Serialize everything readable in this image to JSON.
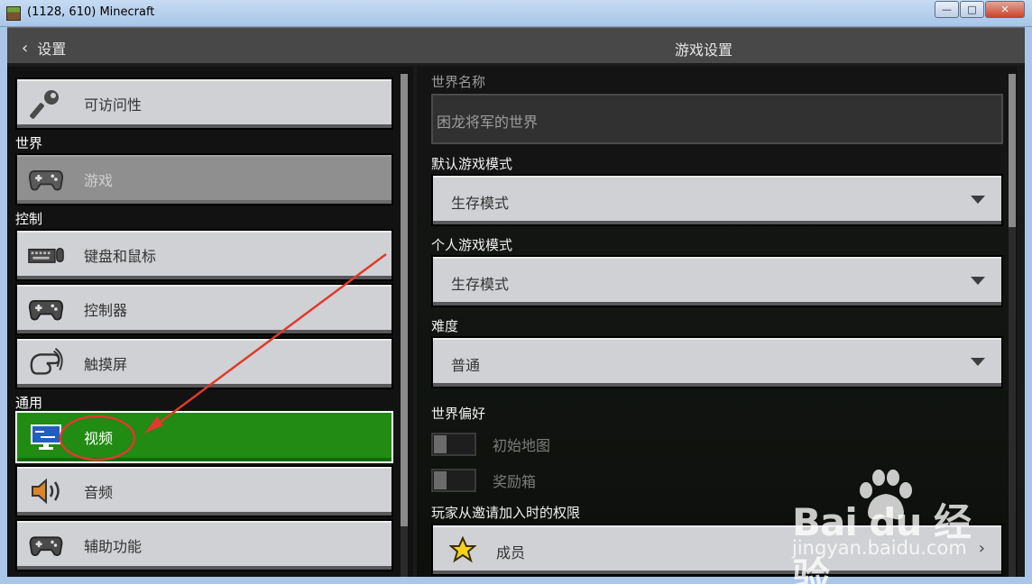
{
  "window": {
    "title": "(1128, 610) Minecraft",
    "minimize": "—",
    "maximize": "□",
    "close": "✕"
  },
  "header": {
    "back_label": "设置",
    "title": "游戏设置"
  },
  "sidebar": {
    "accessibility": {
      "label": "可访问性",
      "icon": "key-icon"
    },
    "section_world": "世界",
    "game": {
      "label": "游戏",
      "icon": "gamepad-icon",
      "state": "active"
    },
    "section_controls": "控制",
    "keyboard": {
      "label": "键盘和鼠标",
      "icon": "keyboard-mouse-icon"
    },
    "controller": {
      "label": "控制器",
      "icon": "gamepad-icon"
    },
    "touch": {
      "label": "触摸屏",
      "icon": "touch-hand-icon"
    },
    "section_general": "通用",
    "video": {
      "label": "视频",
      "icon": "monitor-icon",
      "state": "selected"
    },
    "audio": {
      "label": "音频",
      "icon": "speaker-icon"
    },
    "assist": {
      "label": "辅助功能",
      "icon": "gamepad-icon"
    }
  },
  "panel": {
    "world_name_label": "世界名称",
    "world_name_value": "困龙将军的世界",
    "default_mode_label": "默认游戏模式",
    "default_mode_value": "生存模式",
    "personal_mode_label": "个人游戏模式",
    "personal_mode_value": "生存模式",
    "difficulty_label": "难度",
    "difficulty_value": "普通",
    "world_prefs_label": "世界偏好",
    "starter_map_label": "初始地图",
    "starter_map_on": false,
    "bonus_chest_label": "奖励箱",
    "bonus_chest_on": false,
    "invite_permission_label": "玩家从邀请加入时的权限",
    "invite_permission_value": "成员",
    "invite_permission_icon": "star-icon"
  },
  "watermark": {
    "brand": "Bai  du 经验",
    "url": "jingyan.baidu.com"
  },
  "colors": {
    "selected_green": "#218b13",
    "annotation_red": "#e03a2c"
  }
}
